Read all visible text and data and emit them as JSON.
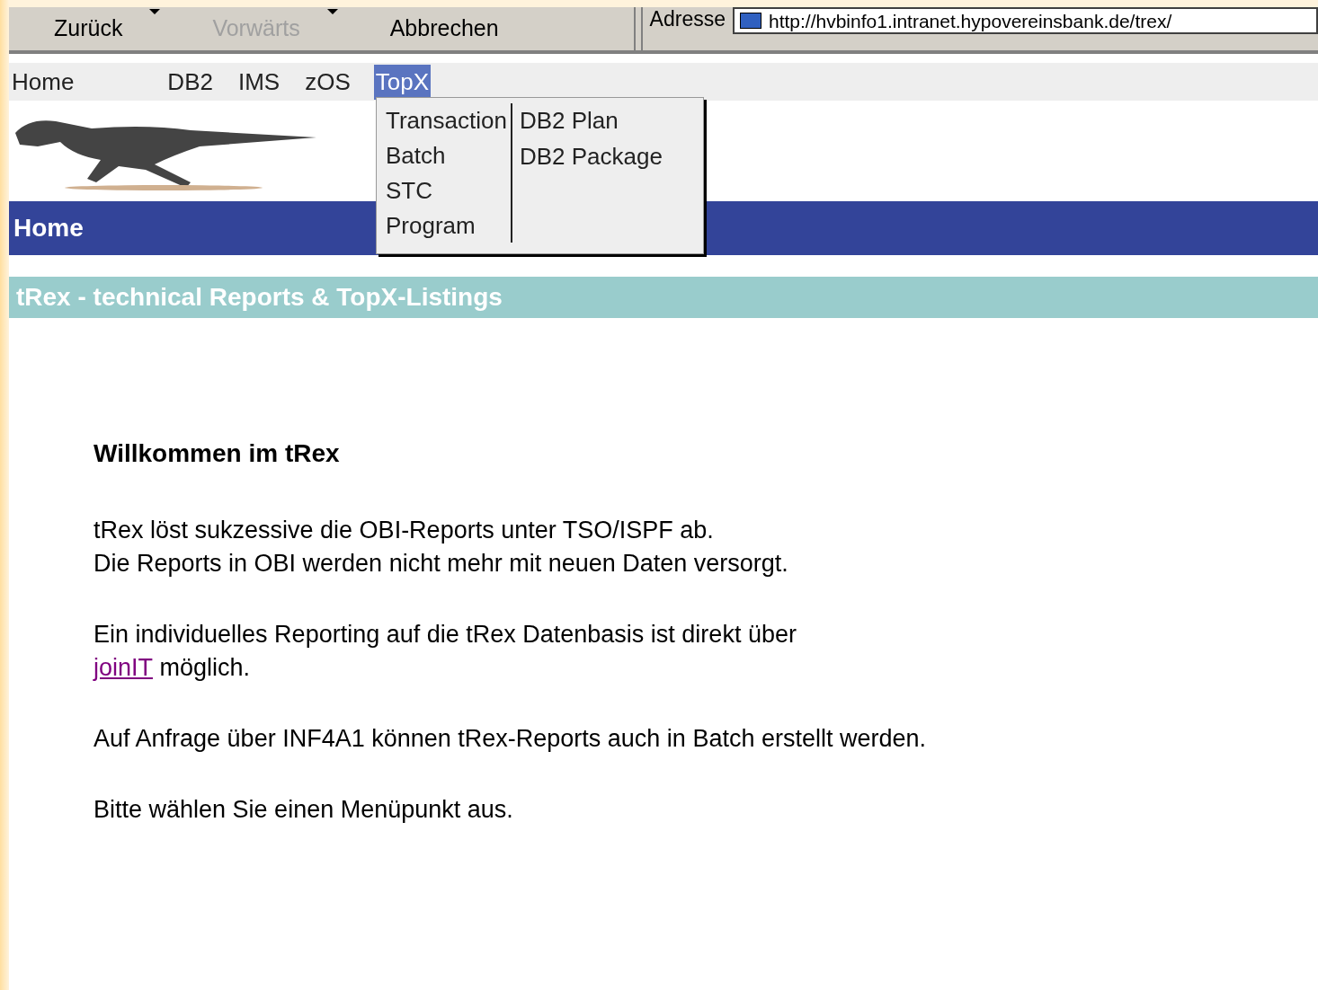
{
  "toolbar": {
    "buttons": [
      {
        "label": "Zurück",
        "disabled": false,
        "dropdown": true
      },
      {
        "label": "Vorwärts",
        "disabled": true,
        "dropdown": true
      },
      {
        "label": "Abbrechen",
        "disabled": false,
        "dropdown": false
      }
    ],
    "address_label": "Adresse",
    "url": "http://hvbinfo1.intranet.hypovereinsbank.de/trex/"
  },
  "menu": [
    {
      "label": "Home",
      "selected": false
    },
    {
      "label": "DB2",
      "selected": false
    },
    {
      "label": "IMS",
      "selected": false
    },
    {
      "label": "zOS",
      "selected": false
    },
    {
      "label": "TopX",
      "selected": true
    }
  ],
  "dropdown": {
    "columns": [
      [
        "Transaction",
        "Batch",
        "STC",
        "Program"
      ],
      [
        "DB2 Plan",
        "DB2 Package"
      ]
    ]
  },
  "page_title": "Home",
  "subtitle": "tRex - technical Reports & TopX-Listings",
  "content": {
    "heading": "Willkommen im tRex",
    "paragraphs": [
      {
        "lines": [
          "tRex löst sukzessive die OBI-Reports unter TSO/ISPF ab.",
          "Die Reports in OBI werden nicht mehr mit neuen Daten versorgt."
        ]
      },
      {
        "lines": [
          "Ein individuelles Reporting auf die tRex Datenbasis ist direkt über"
        ],
        "link": "joinIT",
        "after_link": " möglich."
      },
      {
        "lines": [
          "Auf Anfrage über INF4A1 können tRex-Reports auch in Batch erstellt werden."
        ]
      },
      {
        "lines": [
          "Bitte wählen Sie einen Menüpunkt aus."
        ]
      }
    ]
  }
}
